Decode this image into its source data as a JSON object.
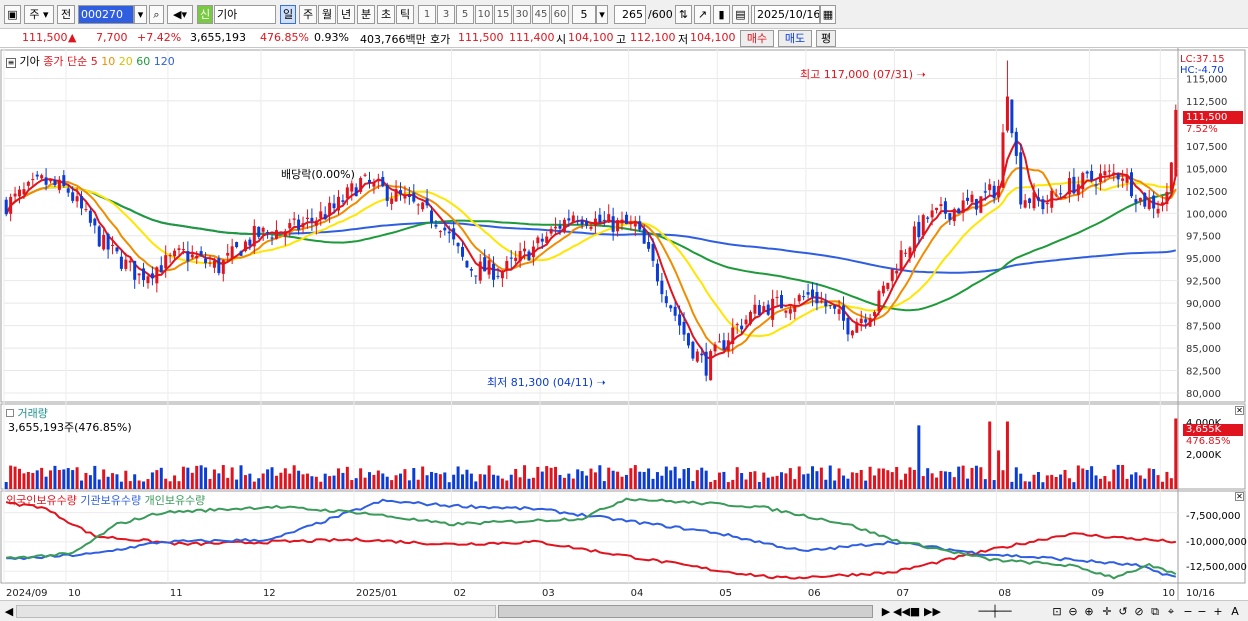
{
  "toolbar": {
    "type_select": "주",
    "prev_label": "전",
    "code_value": "000270",
    "new_label": "신",
    "name_value": "기아",
    "periods": [
      "일",
      "주",
      "월",
      "년",
      "분",
      "초",
      "틱"
    ],
    "intervals": [
      "1",
      "3",
      "5",
      "10",
      "15",
      "30",
      "45",
      "60"
    ],
    "interval_value": "5",
    "count_value": "265",
    "count_total": "/600",
    "date_value": "2025/10/16"
  },
  "quote": {
    "price": "111,500",
    "arrow": "▲",
    "change": "7,700",
    "change_pct": "+7.42%",
    "volume": "3,655,193",
    "volume_pct": "476.85%",
    "turnover_pct": "0.93%",
    "amount": "403,766백만",
    "bid_label": "호가",
    "bid1": "111,500",
    "bid2": "111,400",
    "open_label": "시",
    "open": "104,100",
    "high_label": "고",
    "high": "112,100",
    "low_label": "저",
    "low": "104,100",
    "buy_label": "매수",
    "sell_label": "매도",
    "eval_label": "평"
  },
  "price_panel": {
    "name": "기아",
    "ma_label": "종가 단순",
    "ma_periods": [
      "5",
      "10",
      "20",
      "60",
      "120"
    ],
    "lc": "LC:37.15",
    "hc": "HC:-4.70",
    "high_note": "최고 117,000 (07/31)",
    "low_note": "최저 81,300 (04/11)",
    "dividend_note": "배당락(0.00%)",
    "last_price_tag": "111,500",
    "last_pct_tag": "7.52%",
    "y_ticks": [
      "115,000",
      "112,500",
      "107,500",
      "105,000",
      "102,500",
      "100,000",
      "97,500",
      "95,000",
      "92,500",
      "90,000",
      "87,500",
      "85,000",
      "82,500",
      "80,000"
    ]
  },
  "volume_panel": {
    "title": "거래량",
    "value": "3,655,193주(476.85%)",
    "tag_value": "3,655K",
    "tag_pct": "476.85%",
    "y_tick_top": "4,000K",
    "y_tick": "2,000K"
  },
  "holding_panel": {
    "series": [
      "외국인보유수량",
      "기관보유수량",
      "개인보유수량"
    ],
    "y_ticks": [
      "-7,500,000",
      "-10,000,000",
      "-12,500,000"
    ]
  },
  "x_axis": {
    "labels": [
      "2024/09",
      "10",
      "11",
      "12",
      "2025/01",
      "02",
      "03",
      "04",
      "05",
      "06",
      "07",
      "08",
      "09",
      "10",
      "10/16"
    ]
  },
  "colors": {
    "up": "#e0141e",
    "down": "#0b3cd6",
    "ma5": "#e0141e",
    "ma10": "#f08c00",
    "ma20": "#ffe600",
    "ma60": "#1f9a3a",
    "ma120": "#2f5fe0",
    "foreign": "#e0141e",
    "institution": "#2f5fe0",
    "individual": "#3a9a5a"
  }
}
